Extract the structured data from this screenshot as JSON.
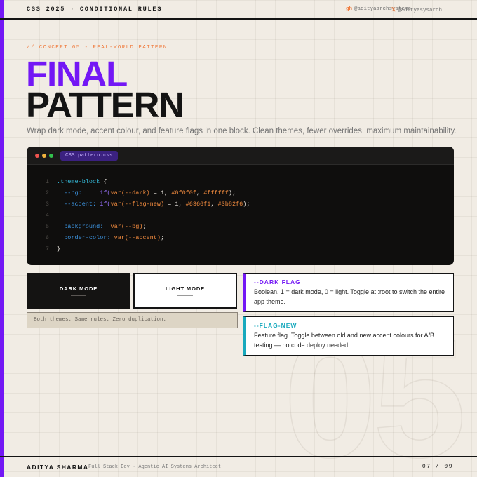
{
  "header": {
    "title": "CSS 2025 · CONDITIONAL RULES",
    "socials": [
      {
        "glyph": "gh",
        "handle": "@adityaarchsystems"
      },
      {
        "glyph": "𝕏",
        "handle": "@adityasysarch"
      }
    ]
  },
  "hero": {
    "eyebrow": "// CONCEPT 05 - REAL-WORLD PATTERN",
    "title_accent": "FINAL",
    "title_main": "PATTERN",
    "subtitle": "Wrap dark mode, accent colour, and feature flags in one block. Clean themes, fewer overrides, maximum maintainability.",
    "background_number": "05"
  },
  "code_window": {
    "filename": "CSS pattern.css",
    "lines": [
      {
        "num": "1",
        "tokens": [
          {
            "t": ".theme-block",
            "k": "sel"
          },
          {
            "t": " {",
            "k": "pun"
          }
        ]
      },
      {
        "num": "2",
        "tokens": [
          {
            "t": "  --bg:",
            "k": "prop"
          },
          {
            "t": "     ",
            "k": "pun"
          },
          {
            "t": "if(",
            "k": "fn"
          },
          {
            "t": "var(--dark)",
            "k": "val"
          },
          {
            "t": " = 1, ",
            "k": "pun"
          },
          {
            "t": "#0f0f0f",
            "k": "val"
          },
          {
            "t": ", ",
            "k": "pun"
          },
          {
            "t": "#ffffff",
            "k": "val"
          },
          {
            "t": ");",
            "k": "pun"
          }
        ]
      },
      {
        "num": "3",
        "tokens": [
          {
            "t": "  --accent:",
            "k": "prop"
          },
          {
            "t": " ",
            "k": "pun"
          },
          {
            "t": "if(",
            "k": "fn"
          },
          {
            "t": "var(--flag-new)",
            "k": "val"
          },
          {
            "t": " = 1, ",
            "k": "pun"
          },
          {
            "t": "#6366f1",
            "k": "val"
          },
          {
            "t": ", ",
            "k": "pun"
          },
          {
            "t": "#3b82f6",
            "k": "val"
          },
          {
            "t": ");",
            "k": "pun"
          }
        ]
      },
      {
        "num": "4",
        "tokens": []
      },
      {
        "num": "5",
        "tokens": [
          {
            "t": "  background:",
            "k": "prop"
          },
          {
            "t": "  ",
            "k": "pun"
          },
          {
            "t": "var(--bg)",
            "k": "val"
          },
          {
            "t": ";",
            "k": "pun"
          }
        ]
      },
      {
        "num": "6",
        "tokens": [
          {
            "t": "  border-color:",
            "k": "prop"
          },
          {
            "t": " ",
            "k": "pun"
          },
          {
            "t": "var(--accent)",
            "k": "val"
          },
          {
            "t": ";",
            "k": "pun"
          }
        ]
      },
      {
        "num": "7",
        "tokens": [
          {
            "t": "}",
            "k": "pun"
          }
        ]
      }
    ]
  },
  "themes": {
    "dark_label": "DARK MODE",
    "light_label": "LIGHT MODE",
    "note": "Both themes. Same rules. Zero duplication."
  },
  "flags": [
    {
      "title": "--DARK FLAG",
      "desc": "Boolean. 1 = dark mode, 0 = light. Toggle at :root to switch the entire app theme."
    },
    {
      "title": "--FLAG-NEW",
      "desc": "Feature flag. Toggle between old and new accent colours for A/B testing — no code deploy needed."
    }
  ],
  "footer": {
    "name": "ADITYA SHARMA",
    "role": "Full Stack Dev · Agentic AI Systems Architect",
    "page": "07 / 09"
  },
  "colors": {
    "accent_purple": "#7317f5",
    "accent_orange": "#f07a3c",
    "accent_cyan": "#18a9bd",
    "background": "#f1ece4"
  }
}
